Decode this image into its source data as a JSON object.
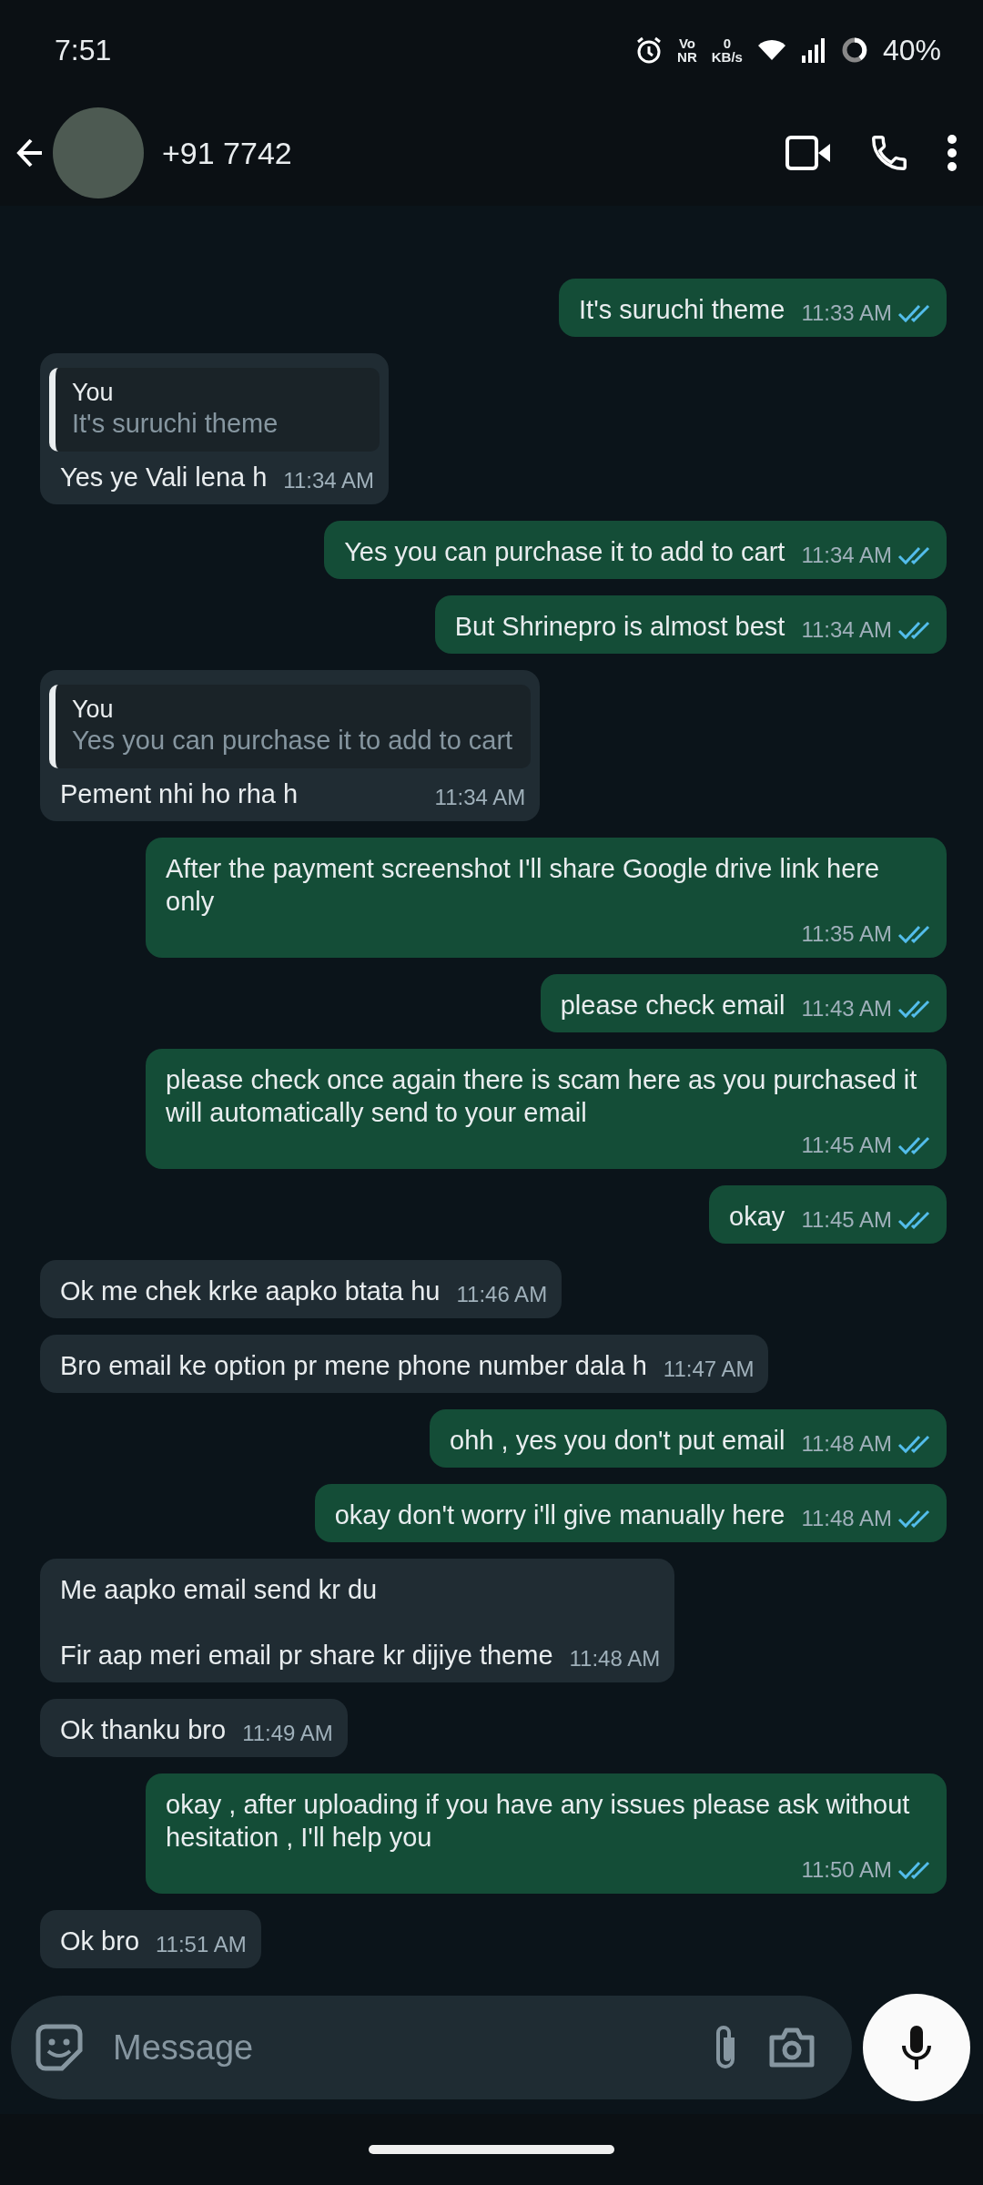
{
  "status_bar": {
    "time": "7:51",
    "network": "Vo\nNR",
    "speed": "0\nKB/s",
    "battery": "40%"
  },
  "header": {
    "contact": "+91 7742"
  },
  "messages": [
    {
      "kind": "out",
      "text": "It's suruchi theme",
      "time": "11:33 AM",
      "read": true
    },
    {
      "kind": "in",
      "quote": {
        "author": "You",
        "text": "It's suruchi theme"
      },
      "text": "Yes ye Vali lena h",
      "time": "11:34 AM"
    },
    {
      "kind": "out",
      "text": "Yes you can purchase it to add to cart",
      "time": "11:34 AM",
      "read": true
    },
    {
      "kind": "out",
      "text": "But Shrinepro is almost best",
      "time": "11:34 AM",
      "read": true
    },
    {
      "kind": "in",
      "quote": {
        "author": "You",
        "text": "Yes you can purchase it to add to cart"
      },
      "text": "Pement nhi ho rha h",
      "time": "11:34 AM"
    },
    {
      "kind": "out",
      "text": "After the payment screenshot I'll share Google drive link here only",
      "time": "11:35 AM",
      "read": true
    },
    {
      "kind": "out",
      "text": "please check email",
      "time": "11:43 AM",
      "read": true
    },
    {
      "kind": "out",
      "text": "please check once again there is scam here as you purchased it will automatically send to your email",
      "time": "11:45 AM",
      "read": true
    },
    {
      "kind": "out",
      "text": "okay",
      "time": "11:45 AM",
      "read": true
    },
    {
      "kind": "in",
      "text": "Ok me chek krke aapko btata hu",
      "time": "11:46 AM"
    },
    {
      "kind": "in",
      "text": "Bro email ke option pr mene phone number dala h",
      "time": "11:47 AM"
    },
    {
      "kind": "out",
      "text": "ohh , yes you don't put email",
      "time": "11:48 AM",
      "read": true
    },
    {
      "kind": "out",
      "text": "okay don't worry i'll give manually here",
      "time": "11:48 AM",
      "read": true
    },
    {
      "kind": "in",
      "text": "Me aapko email send kr du\n\nFir aap meri email pr share kr dijiye theme",
      "time": "11:48 AM"
    },
    {
      "kind": "in",
      "text": "Ok thanku bro",
      "time": "11:49 AM"
    },
    {
      "kind": "out",
      "text": "okay , after uploading if you have any issues please ask without hesitation , I'll help you",
      "time": "11:50 AM",
      "read": true
    },
    {
      "kind": "in",
      "text": "Ok bro",
      "time": "11:51 AM"
    }
  ],
  "composer": {
    "placeholder": "Message"
  }
}
